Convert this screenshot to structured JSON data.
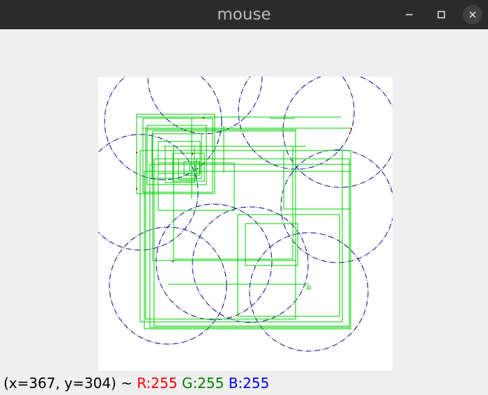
{
  "window": {
    "title": "mouse"
  },
  "controls": {
    "minimize_icon": "minimize-icon",
    "maximize_icon": "maximize-icon",
    "close_icon": "close-icon"
  },
  "status": {
    "coords": "(x=367, y=304) ~",
    "r_label": "R:255",
    "g_label": "G:255",
    "b_label": "B:255"
  },
  "colors": {
    "titlebar": "#2b2b2b",
    "circle_stroke": "#00008b",
    "rect_stroke": "#00cc00",
    "red_text": "#ff0000",
    "green_text": "#008000",
    "blue_text": "#0000ff"
  }
}
